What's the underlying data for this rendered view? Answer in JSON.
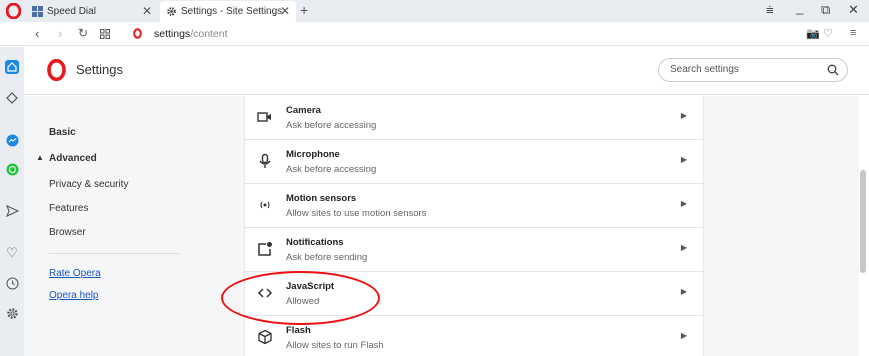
{
  "tabs": [
    {
      "label": "Speed Dial",
      "icon": "grid-icon"
    },
    {
      "label": "Settings - Site Settings",
      "icon": "gear-icon"
    }
  ],
  "address": {
    "host": "settings",
    "path": "/content"
  },
  "header": {
    "title": "Settings",
    "search_placeholder": "Search settings"
  },
  "leftnav": {
    "basic": "Basic",
    "advanced": "Advanced",
    "items": [
      "Privacy & security",
      "Features",
      "Browser"
    ],
    "links": [
      "Rate Opera",
      "Opera help"
    ]
  },
  "rows": [
    {
      "title": "Camera",
      "sub": "Ask before accessing",
      "icon": "camera-icon"
    },
    {
      "title": "Microphone",
      "sub": "Ask before accessing",
      "icon": "microphone-icon"
    },
    {
      "title": "Motion sensors",
      "sub": "Allow sites to use motion sensors",
      "icon": "motion-sensor-icon"
    },
    {
      "title": "Notifications",
      "sub": "Ask before sending",
      "icon": "notification-icon"
    },
    {
      "title": "JavaScript",
      "sub": "Allowed",
      "icon": "code-icon"
    },
    {
      "title": "Flash",
      "sub": "Allow sites to run Flash",
      "icon": "puzzle-icon"
    }
  ],
  "colors": {
    "opera_red": "#e5191e",
    "link": "#1a56c4",
    "messenger": "#1e88e5",
    "whatsapp": "#25c243",
    "annotation": "#e11111"
  }
}
